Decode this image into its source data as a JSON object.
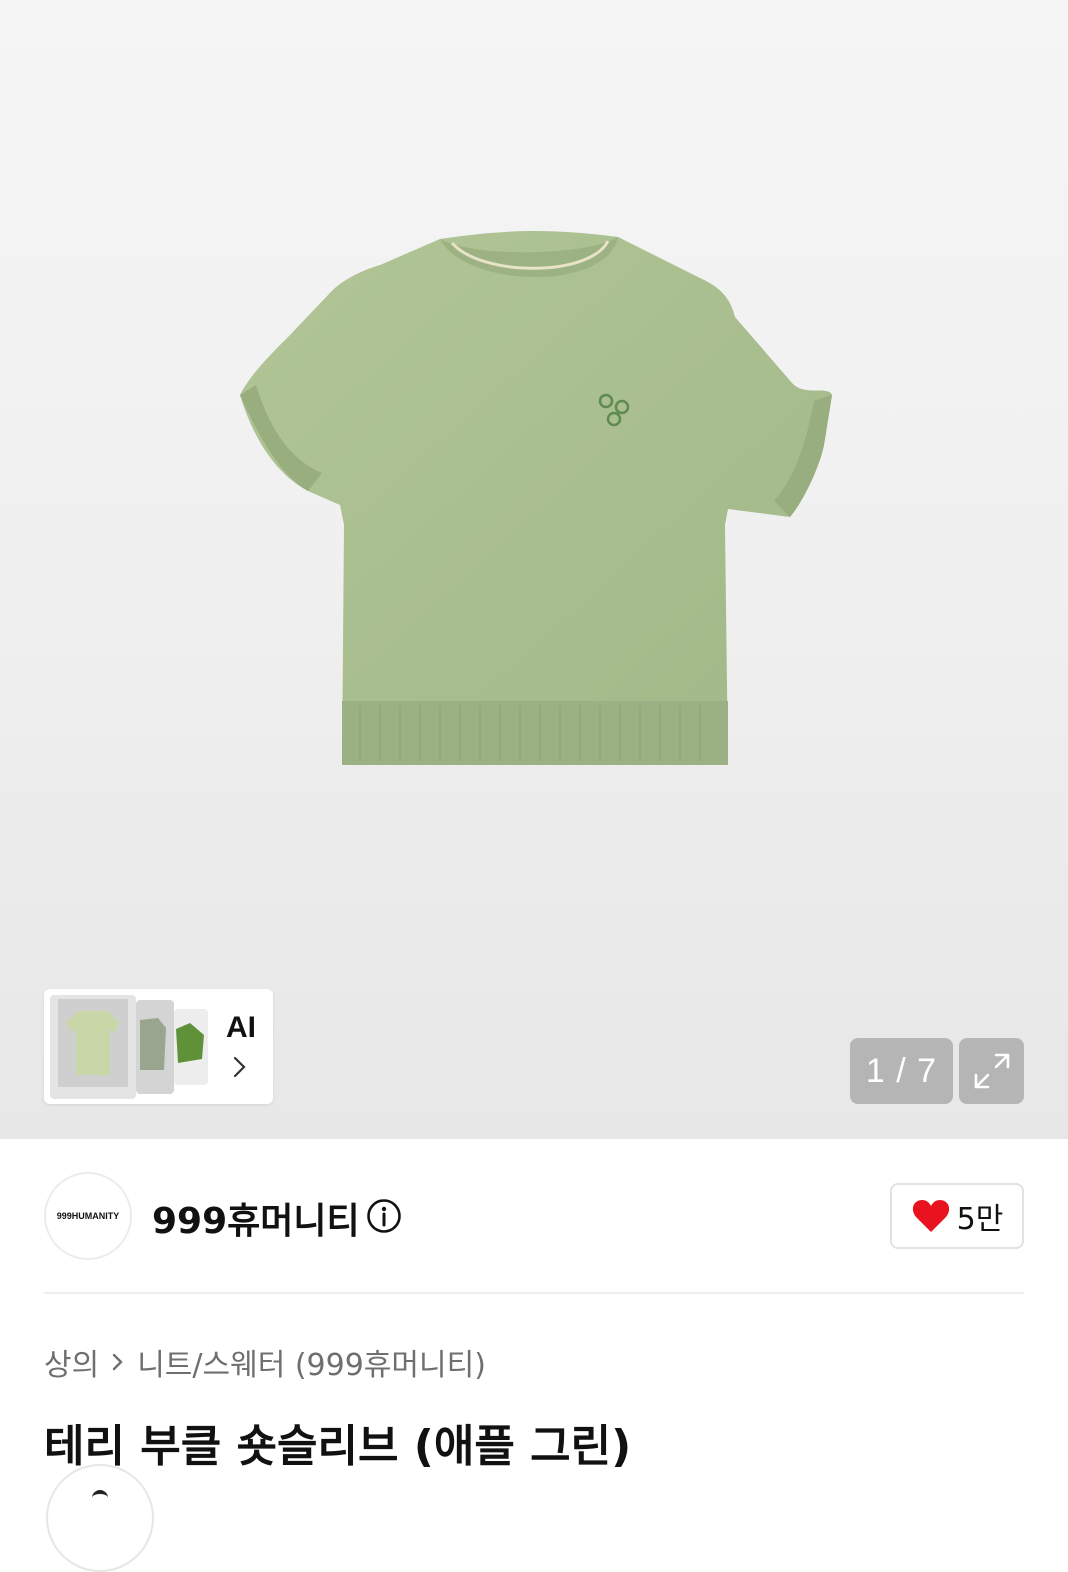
{
  "gallery": {
    "product_image": "green short-sleeve knit sweater",
    "ai_label": "AI",
    "counter": "1 / 7",
    "expand_icon": "expand-arrows-icon"
  },
  "brand": {
    "logo_text": "999HUMANITY",
    "name": "999휴머니티",
    "info_icon": "info-icon",
    "like_count": "5만",
    "like_color": "#e8131f"
  },
  "breadcrumb": {
    "category": "상의",
    "separator_icon": "chevron-right-icon",
    "subcategory": "니트/스웨터 (999휴머니티)"
  },
  "product": {
    "title": "테리 부클 숏슬리브 (애플 그린)"
  },
  "colors": {
    "sweater": "#a7bd8c",
    "background": "#f2f2f2"
  }
}
